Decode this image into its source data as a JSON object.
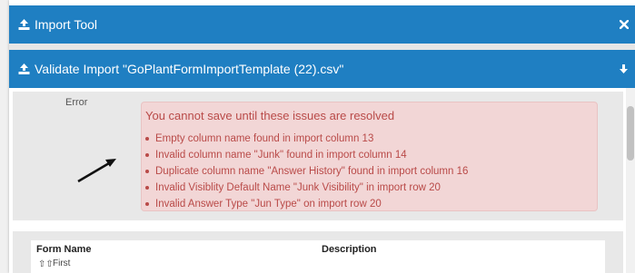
{
  "header": {
    "title": "Import Tool",
    "close_glyph": "✖"
  },
  "validate": {
    "title": "Validate Import \"GoPlantFormImportTemplate (22).csv\""
  },
  "error": {
    "label": "Error",
    "title": "You cannot save until these issues are resolved",
    "items": [
      "Empty column name found in import column 13",
      "Invalid column name \"Junk\" found in import column 14",
      "Duplicate column name \"Answer History\" found in import column 16",
      "Invalid Visiblity Default Name \"Junk Visibility\" in import row 20",
      "Invalid Answer Type \"Jun Type\" on import row 20"
    ]
  },
  "table": {
    "columns": [
      "Form Name",
      "Description"
    ],
    "sort_label": "First",
    "sort_glyph": "⇧⇧"
  },
  "colors": {
    "accent": "#1f7fc2",
    "error_text": "#b94a48",
    "error_bg": "#f2d6d6"
  },
  "icons": [
    "upload-icon",
    "close-icon",
    "arrow-down-icon",
    "arrow-pointer"
  ]
}
